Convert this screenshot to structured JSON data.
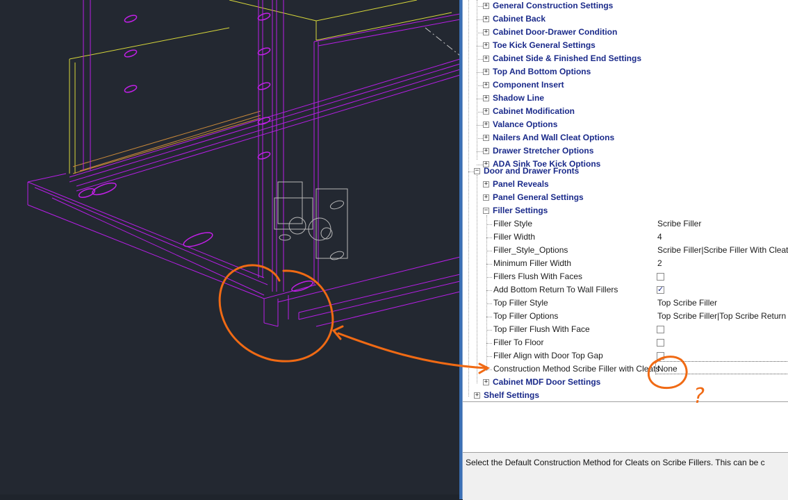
{
  "tree": {
    "sub_categories_a": [
      "General Construction Settings",
      "Cabinet Back",
      "Cabinet Door-Drawer Condition",
      "Toe Kick General Settings",
      "Cabinet Side & Finished End Settings",
      "Top And Bottom Options",
      "Component Insert",
      "Shadow Line",
      "Cabinet Modification",
      "Valance Options",
      "Nailers And Wall Cleat Options",
      "Drawer Stretcher Options",
      "ADA Sink Toe Kick Options"
    ],
    "door_fronts": {
      "label": "Door and Drawer Fronts",
      "panel_reveals": "Panel Reveals",
      "panel_general": "Panel General Settings",
      "filler_settings": "Filler Settings",
      "mdf_door": "Cabinet MDF Door Settings"
    },
    "filler_properties": [
      {
        "name": "Filler Style",
        "value": "Scribe Filler"
      },
      {
        "name": "Filler Width",
        "value": "4"
      },
      {
        "name": "Filler_Style_Options",
        "value": "Scribe Filler|Scribe Filler With Cleats|"
      },
      {
        "name": "Minimum Filler Width",
        "value": "2"
      },
      {
        "name": "Fillers Flush With Faces",
        "checked": false
      },
      {
        "name": "Add Bottom Return To Wall Fillers",
        "checked": true
      },
      {
        "name": "Top Filler Style",
        "value": "Top Scribe Filler"
      },
      {
        "name": "Top Filler Options",
        "value": "Top Scribe Filler|Top Scribe Return Fi"
      },
      {
        "name": "Top Filler Flush With Face",
        "checked": false
      },
      {
        "name": "Filler To Floor",
        "checked": false
      },
      {
        "name": "Filler Align with Door Top Gap",
        "checked": false
      },
      {
        "name": "Construction Method Scribe Filler with Cleats",
        "value": "None"
      }
    ],
    "shelf_settings": "Shelf Settings"
  },
  "description": "Select the Default Construction Method for Cleats on Scribe Fillers. This can be c",
  "annotations": {
    "question_mark": "?",
    "color": "#f06a14"
  },
  "colors": {
    "viewport_bg": "#232831",
    "wire_magenta": "#b81ee8",
    "wire_yellow": "#d8d83a",
    "wire_orange": "#c9893a",
    "category_text": "#1a2a8a"
  }
}
